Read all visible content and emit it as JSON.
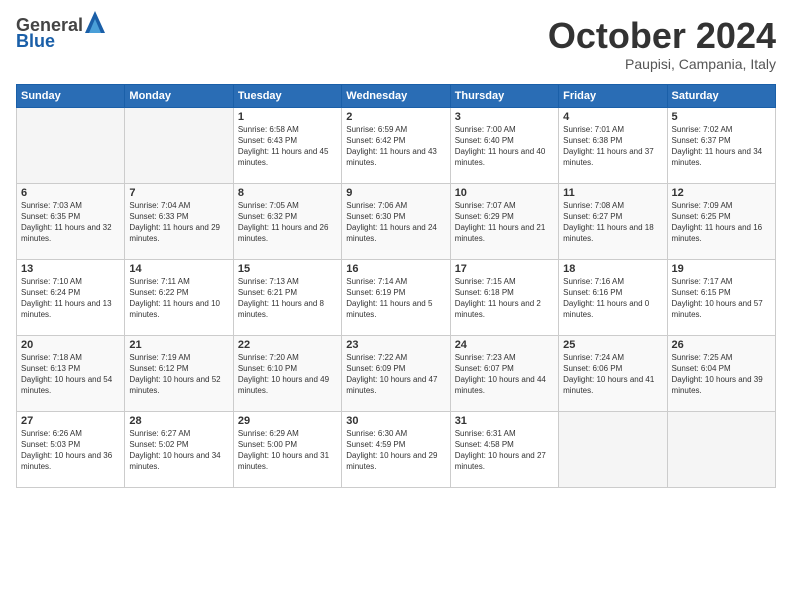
{
  "logo": {
    "general": "General",
    "blue": "Blue"
  },
  "header": {
    "month": "October 2024",
    "location": "Paupisi, Campania, Italy"
  },
  "weekdays": [
    "Sunday",
    "Monday",
    "Tuesday",
    "Wednesday",
    "Thursday",
    "Friday",
    "Saturday"
  ],
  "weeks": [
    [
      {
        "day": "",
        "sunrise": "",
        "sunset": "",
        "daylight": ""
      },
      {
        "day": "",
        "sunrise": "",
        "sunset": "",
        "daylight": ""
      },
      {
        "day": "1",
        "sunrise": "Sunrise: 6:58 AM",
        "sunset": "Sunset: 6:43 PM",
        "daylight": "Daylight: 11 hours and 45 minutes."
      },
      {
        "day": "2",
        "sunrise": "Sunrise: 6:59 AM",
        "sunset": "Sunset: 6:42 PM",
        "daylight": "Daylight: 11 hours and 43 minutes."
      },
      {
        "day": "3",
        "sunrise": "Sunrise: 7:00 AM",
        "sunset": "Sunset: 6:40 PM",
        "daylight": "Daylight: 11 hours and 40 minutes."
      },
      {
        "day": "4",
        "sunrise": "Sunrise: 7:01 AM",
        "sunset": "Sunset: 6:38 PM",
        "daylight": "Daylight: 11 hours and 37 minutes."
      },
      {
        "day": "5",
        "sunrise": "Sunrise: 7:02 AM",
        "sunset": "Sunset: 6:37 PM",
        "daylight": "Daylight: 11 hours and 34 minutes."
      }
    ],
    [
      {
        "day": "6",
        "sunrise": "Sunrise: 7:03 AM",
        "sunset": "Sunset: 6:35 PM",
        "daylight": "Daylight: 11 hours and 32 minutes."
      },
      {
        "day": "7",
        "sunrise": "Sunrise: 7:04 AM",
        "sunset": "Sunset: 6:33 PM",
        "daylight": "Daylight: 11 hours and 29 minutes."
      },
      {
        "day": "8",
        "sunrise": "Sunrise: 7:05 AM",
        "sunset": "Sunset: 6:32 PM",
        "daylight": "Daylight: 11 hours and 26 minutes."
      },
      {
        "day": "9",
        "sunrise": "Sunrise: 7:06 AM",
        "sunset": "Sunset: 6:30 PM",
        "daylight": "Daylight: 11 hours and 24 minutes."
      },
      {
        "day": "10",
        "sunrise": "Sunrise: 7:07 AM",
        "sunset": "Sunset: 6:29 PM",
        "daylight": "Daylight: 11 hours and 21 minutes."
      },
      {
        "day": "11",
        "sunrise": "Sunrise: 7:08 AM",
        "sunset": "Sunset: 6:27 PM",
        "daylight": "Daylight: 11 hours and 18 minutes."
      },
      {
        "day": "12",
        "sunrise": "Sunrise: 7:09 AM",
        "sunset": "Sunset: 6:25 PM",
        "daylight": "Daylight: 11 hours and 16 minutes."
      }
    ],
    [
      {
        "day": "13",
        "sunrise": "Sunrise: 7:10 AM",
        "sunset": "Sunset: 6:24 PM",
        "daylight": "Daylight: 11 hours and 13 minutes."
      },
      {
        "day": "14",
        "sunrise": "Sunrise: 7:11 AM",
        "sunset": "Sunset: 6:22 PM",
        "daylight": "Daylight: 11 hours and 10 minutes."
      },
      {
        "day": "15",
        "sunrise": "Sunrise: 7:13 AM",
        "sunset": "Sunset: 6:21 PM",
        "daylight": "Daylight: 11 hours and 8 minutes."
      },
      {
        "day": "16",
        "sunrise": "Sunrise: 7:14 AM",
        "sunset": "Sunset: 6:19 PM",
        "daylight": "Daylight: 11 hours and 5 minutes."
      },
      {
        "day": "17",
        "sunrise": "Sunrise: 7:15 AM",
        "sunset": "Sunset: 6:18 PM",
        "daylight": "Daylight: 11 hours and 2 minutes."
      },
      {
        "day": "18",
        "sunrise": "Sunrise: 7:16 AM",
        "sunset": "Sunset: 6:16 PM",
        "daylight": "Daylight: 11 hours and 0 minutes."
      },
      {
        "day": "19",
        "sunrise": "Sunrise: 7:17 AM",
        "sunset": "Sunset: 6:15 PM",
        "daylight": "Daylight: 10 hours and 57 minutes."
      }
    ],
    [
      {
        "day": "20",
        "sunrise": "Sunrise: 7:18 AM",
        "sunset": "Sunset: 6:13 PM",
        "daylight": "Daylight: 10 hours and 54 minutes."
      },
      {
        "day": "21",
        "sunrise": "Sunrise: 7:19 AM",
        "sunset": "Sunset: 6:12 PM",
        "daylight": "Daylight: 10 hours and 52 minutes."
      },
      {
        "day": "22",
        "sunrise": "Sunrise: 7:20 AM",
        "sunset": "Sunset: 6:10 PM",
        "daylight": "Daylight: 10 hours and 49 minutes."
      },
      {
        "day": "23",
        "sunrise": "Sunrise: 7:22 AM",
        "sunset": "Sunset: 6:09 PM",
        "daylight": "Daylight: 10 hours and 47 minutes."
      },
      {
        "day": "24",
        "sunrise": "Sunrise: 7:23 AM",
        "sunset": "Sunset: 6:07 PM",
        "daylight": "Daylight: 10 hours and 44 minutes."
      },
      {
        "day": "25",
        "sunrise": "Sunrise: 7:24 AM",
        "sunset": "Sunset: 6:06 PM",
        "daylight": "Daylight: 10 hours and 41 minutes."
      },
      {
        "day": "26",
        "sunrise": "Sunrise: 7:25 AM",
        "sunset": "Sunset: 6:04 PM",
        "daylight": "Daylight: 10 hours and 39 minutes."
      }
    ],
    [
      {
        "day": "27",
        "sunrise": "Sunrise: 6:26 AM",
        "sunset": "Sunset: 5:03 PM",
        "daylight": "Daylight: 10 hours and 36 minutes."
      },
      {
        "day": "28",
        "sunrise": "Sunrise: 6:27 AM",
        "sunset": "Sunset: 5:02 PM",
        "daylight": "Daylight: 10 hours and 34 minutes."
      },
      {
        "day": "29",
        "sunrise": "Sunrise: 6:29 AM",
        "sunset": "Sunset: 5:00 PM",
        "daylight": "Daylight: 10 hours and 31 minutes."
      },
      {
        "day": "30",
        "sunrise": "Sunrise: 6:30 AM",
        "sunset": "Sunset: 4:59 PM",
        "daylight": "Daylight: 10 hours and 29 minutes."
      },
      {
        "day": "31",
        "sunrise": "Sunrise: 6:31 AM",
        "sunset": "Sunset: 4:58 PM",
        "daylight": "Daylight: 10 hours and 27 minutes."
      },
      {
        "day": "",
        "sunrise": "",
        "sunset": "",
        "daylight": ""
      },
      {
        "day": "",
        "sunrise": "",
        "sunset": "",
        "daylight": ""
      }
    ]
  ]
}
